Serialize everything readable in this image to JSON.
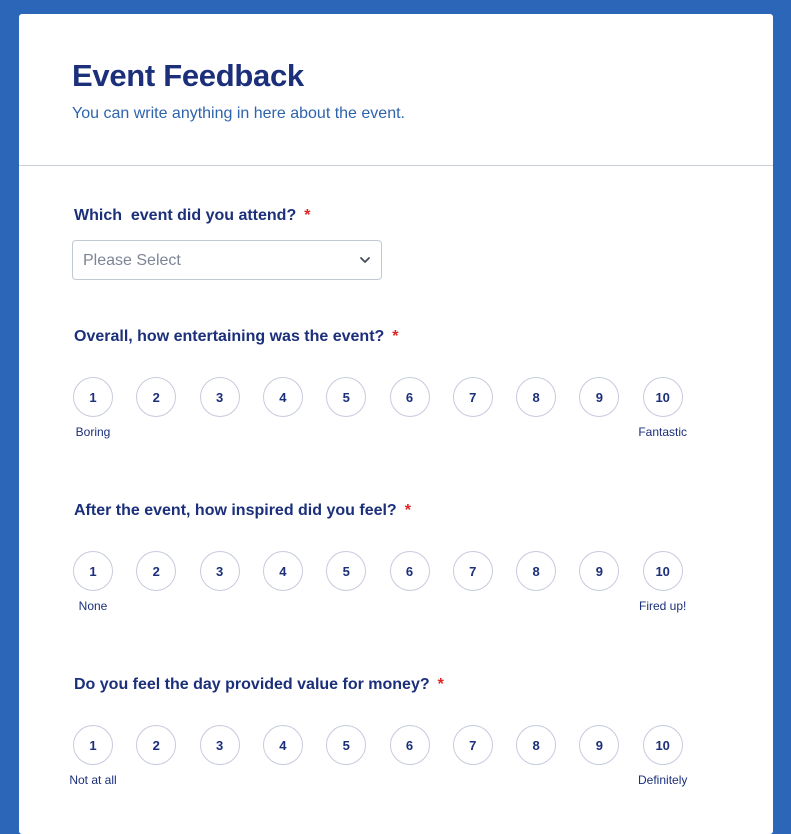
{
  "form": {
    "title": "Event Feedback",
    "subtitle": "You can write anything in here about the event.",
    "required_marker": "*",
    "accent_color": "#2c66b8",
    "text_color": "#1b2f7a"
  },
  "questions": [
    {
      "label": "Which  event did you attend?",
      "type": "dropdown",
      "required": true,
      "placeholder": "Please Select"
    },
    {
      "label": "Overall, how entertaining was the event?",
      "type": "scale",
      "required": true,
      "options": [
        "1",
        "2",
        "3",
        "4",
        "5",
        "6",
        "7",
        "8",
        "9",
        "10"
      ],
      "min_caption": "Boring",
      "max_caption": "Fantastic"
    },
    {
      "label": "After the event, how inspired did you feel?",
      "type": "scale",
      "required": true,
      "options": [
        "1",
        "2",
        "3",
        "4",
        "5",
        "6",
        "7",
        "8",
        "9",
        "10"
      ],
      "min_caption": "None",
      "max_caption": "Fired up!"
    },
    {
      "label": "Do you feel the day provided value for money?",
      "type": "scale",
      "required": true,
      "options": [
        "1",
        "2",
        "3",
        "4",
        "5",
        "6",
        "7",
        "8",
        "9",
        "10"
      ],
      "min_caption": "Not at all",
      "max_caption": "Definitely"
    }
  ]
}
